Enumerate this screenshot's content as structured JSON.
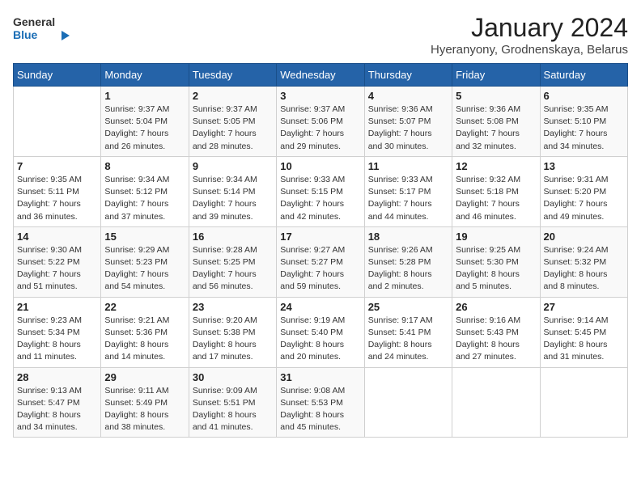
{
  "header": {
    "logo_line1": "General",
    "logo_line2": "Blue",
    "month": "January 2024",
    "location": "Hyeranyony, Grodnenskaya, Belarus"
  },
  "days_of_week": [
    "Sunday",
    "Monday",
    "Tuesday",
    "Wednesday",
    "Thursday",
    "Friday",
    "Saturday"
  ],
  "weeks": [
    [
      {
        "day": "",
        "info": ""
      },
      {
        "day": "1",
        "info": "Sunrise: 9:37 AM\nSunset: 5:04 PM\nDaylight: 7 hours\nand 26 minutes."
      },
      {
        "day": "2",
        "info": "Sunrise: 9:37 AM\nSunset: 5:05 PM\nDaylight: 7 hours\nand 28 minutes."
      },
      {
        "day": "3",
        "info": "Sunrise: 9:37 AM\nSunset: 5:06 PM\nDaylight: 7 hours\nand 29 minutes."
      },
      {
        "day": "4",
        "info": "Sunrise: 9:36 AM\nSunset: 5:07 PM\nDaylight: 7 hours\nand 30 minutes."
      },
      {
        "day": "5",
        "info": "Sunrise: 9:36 AM\nSunset: 5:08 PM\nDaylight: 7 hours\nand 32 minutes."
      },
      {
        "day": "6",
        "info": "Sunrise: 9:35 AM\nSunset: 5:10 PM\nDaylight: 7 hours\nand 34 minutes."
      }
    ],
    [
      {
        "day": "7",
        "info": "Sunrise: 9:35 AM\nSunset: 5:11 PM\nDaylight: 7 hours\nand 36 minutes."
      },
      {
        "day": "8",
        "info": "Sunrise: 9:34 AM\nSunset: 5:12 PM\nDaylight: 7 hours\nand 37 minutes."
      },
      {
        "day": "9",
        "info": "Sunrise: 9:34 AM\nSunset: 5:14 PM\nDaylight: 7 hours\nand 39 minutes."
      },
      {
        "day": "10",
        "info": "Sunrise: 9:33 AM\nSunset: 5:15 PM\nDaylight: 7 hours\nand 42 minutes."
      },
      {
        "day": "11",
        "info": "Sunrise: 9:33 AM\nSunset: 5:17 PM\nDaylight: 7 hours\nand 44 minutes."
      },
      {
        "day": "12",
        "info": "Sunrise: 9:32 AM\nSunset: 5:18 PM\nDaylight: 7 hours\nand 46 minutes."
      },
      {
        "day": "13",
        "info": "Sunrise: 9:31 AM\nSunset: 5:20 PM\nDaylight: 7 hours\nand 49 minutes."
      }
    ],
    [
      {
        "day": "14",
        "info": "Sunrise: 9:30 AM\nSunset: 5:22 PM\nDaylight: 7 hours\nand 51 minutes."
      },
      {
        "day": "15",
        "info": "Sunrise: 9:29 AM\nSunset: 5:23 PM\nDaylight: 7 hours\nand 54 minutes."
      },
      {
        "day": "16",
        "info": "Sunrise: 9:28 AM\nSunset: 5:25 PM\nDaylight: 7 hours\nand 56 minutes."
      },
      {
        "day": "17",
        "info": "Sunrise: 9:27 AM\nSunset: 5:27 PM\nDaylight: 7 hours\nand 59 minutes."
      },
      {
        "day": "18",
        "info": "Sunrise: 9:26 AM\nSunset: 5:28 PM\nDaylight: 8 hours\nand 2 minutes."
      },
      {
        "day": "19",
        "info": "Sunrise: 9:25 AM\nSunset: 5:30 PM\nDaylight: 8 hours\nand 5 minutes."
      },
      {
        "day": "20",
        "info": "Sunrise: 9:24 AM\nSunset: 5:32 PM\nDaylight: 8 hours\nand 8 minutes."
      }
    ],
    [
      {
        "day": "21",
        "info": "Sunrise: 9:23 AM\nSunset: 5:34 PM\nDaylight: 8 hours\nand 11 minutes."
      },
      {
        "day": "22",
        "info": "Sunrise: 9:21 AM\nSunset: 5:36 PM\nDaylight: 8 hours\nand 14 minutes."
      },
      {
        "day": "23",
        "info": "Sunrise: 9:20 AM\nSunset: 5:38 PM\nDaylight: 8 hours\nand 17 minutes."
      },
      {
        "day": "24",
        "info": "Sunrise: 9:19 AM\nSunset: 5:40 PM\nDaylight: 8 hours\nand 20 minutes."
      },
      {
        "day": "25",
        "info": "Sunrise: 9:17 AM\nSunset: 5:41 PM\nDaylight: 8 hours\nand 24 minutes."
      },
      {
        "day": "26",
        "info": "Sunrise: 9:16 AM\nSunset: 5:43 PM\nDaylight: 8 hours\nand 27 minutes."
      },
      {
        "day": "27",
        "info": "Sunrise: 9:14 AM\nSunset: 5:45 PM\nDaylight: 8 hours\nand 31 minutes."
      }
    ],
    [
      {
        "day": "28",
        "info": "Sunrise: 9:13 AM\nSunset: 5:47 PM\nDaylight: 8 hours\nand 34 minutes."
      },
      {
        "day": "29",
        "info": "Sunrise: 9:11 AM\nSunset: 5:49 PM\nDaylight: 8 hours\nand 38 minutes."
      },
      {
        "day": "30",
        "info": "Sunrise: 9:09 AM\nSunset: 5:51 PM\nDaylight: 8 hours\nand 41 minutes."
      },
      {
        "day": "31",
        "info": "Sunrise: 9:08 AM\nSunset: 5:53 PM\nDaylight: 8 hours\nand 45 minutes."
      },
      {
        "day": "",
        "info": ""
      },
      {
        "day": "",
        "info": ""
      },
      {
        "day": "",
        "info": ""
      }
    ]
  ]
}
